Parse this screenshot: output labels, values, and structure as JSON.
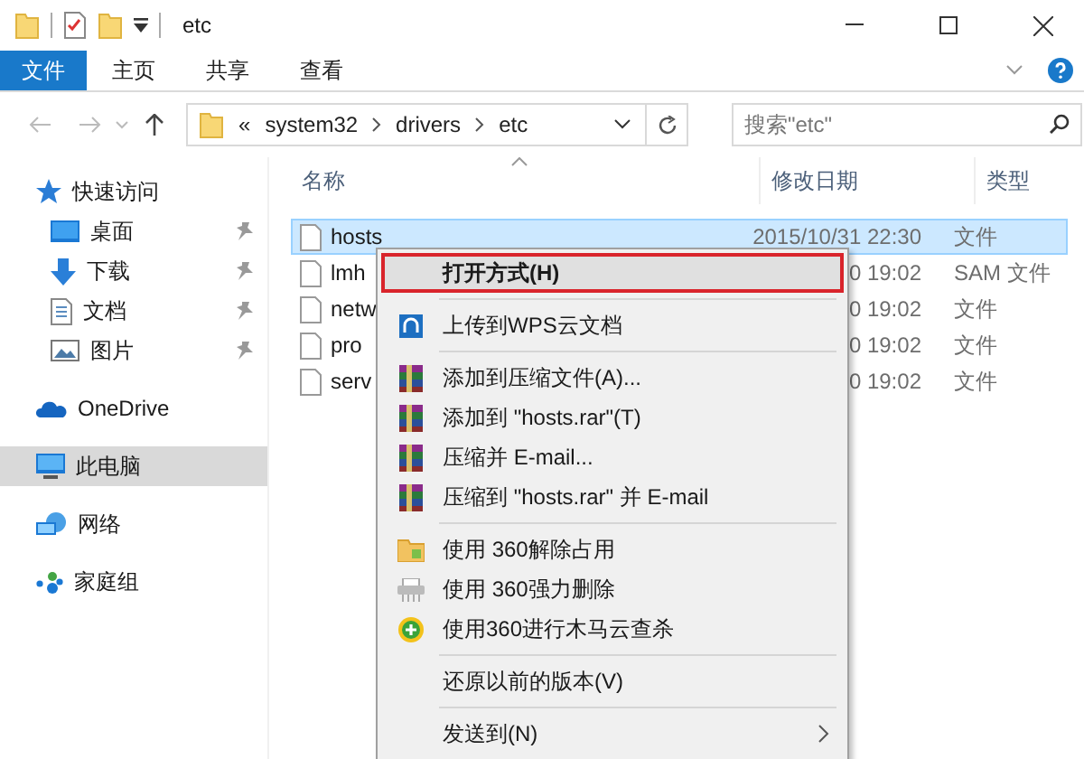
{
  "window": {
    "title": "etc"
  },
  "ribbon_tabs": [
    {
      "label": "文件",
      "selected": true
    },
    {
      "label": "主页",
      "selected": false
    },
    {
      "label": "共享",
      "selected": false
    },
    {
      "label": "查看",
      "selected": false
    }
  ],
  "address": {
    "overflow": "«",
    "crumbs": [
      "system32",
      "drivers",
      "etc"
    ]
  },
  "search": {
    "placeholder": "搜索\"etc\""
  },
  "sidebar": {
    "items": [
      {
        "label": "快速访问",
        "kind": "star",
        "pinned": false,
        "selected": false,
        "children": [
          {
            "label": "桌面",
            "kind": "desktop",
            "pinned": true,
            "selected": false
          },
          {
            "label": "下载",
            "kind": "download",
            "pinned": true,
            "selected": false
          },
          {
            "label": "文档",
            "kind": "document",
            "pinned": true,
            "selected": false
          },
          {
            "label": "图片",
            "kind": "picture",
            "pinned": true,
            "selected": false
          }
        ]
      },
      {
        "label": "OneDrive",
        "kind": "cloud",
        "pinned": false,
        "selected": false
      },
      {
        "label": "此电脑",
        "kind": "computer",
        "pinned": false,
        "selected": true
      },
      {
        "label": "网络",
        "kind": "network",
        "pinned": false,
        "selected": false
      },
      {
        "label": "家庭组",
        "kind": "homegroup",
        "pinned": false,
        "selected": false
      }
    ]
  },
  "table": {
    "columns": [
      "名称",
      "修改日期",
      "类型"
    ],
    "rows": [
      {
        "name": "hosts",
        "date": "2015/10/31 22:30",
        "type": "文件",
        "selected": true
      },
      {
        "name": "lmh",
        "date": "0 19:02",
        "type": "SAM 文件",
        "selected": false
      },
      {
        "name": "netw",
        "date": "0 19:02",
        "type": "文件",
        "selected": false
      },
      {
        "name": "pro",
        "date": "0 19:02",
        "type": "文件",
        "selected": false
      },
      {
        "name": "serv",
        "date": "0 19:02",
        "type": "文件",
        "selected": false
      }
    ]
  },
  "context_menu": {
    "items": [
      {
        "kind": "plain",
        "label": "打开方式(H)",
        "selected": true
      },
      {
        "kind": "separator"
      },
      {
        "kind": "wps",
        "label": "上传到WPS云文档",
        "selected": false
      },
      {
        "kind": "separator"
      },
      {
        "kind": "archive",
        "label": "添加到压缩文件(A)...",
        "selected": false
      },
      {
        "kind": "archive",
        "label": "添加到 \"hosts.rar\"(T)",
        "selected": false
      },
      {
        "kind": "archive",
        "label": "压缩并 E-mail...",
        "selected": false
      },
      {
        "kind": "archive",
        "label": "压缩到 \"hosts.rar\" 并 E-mail",
        "selected": false
      },
      {
        "kind": "separator"
      },
      {
        "kind": "unlock",
        "label": "使用 360解除占用",
        "selected": false
      },
      {
        "kind": "shredder",
        "label": "使用 360强力删除",
        "selected": false
      },
      {
        "kind": "shield",
        "label": "使用360进行木马云查杀",
        "selected": false
      },
      {
        "kind": "separator"
      },
      {
        "kind": "plain",
        "label": "还原以前的版本(V)",
        "selected": false
      },
      {
        "kind": "separator"
      },
      {
        "kind": "submenu",
        "label": "发送到(N)",
        "selected": false
      }
    ]
  }
}
